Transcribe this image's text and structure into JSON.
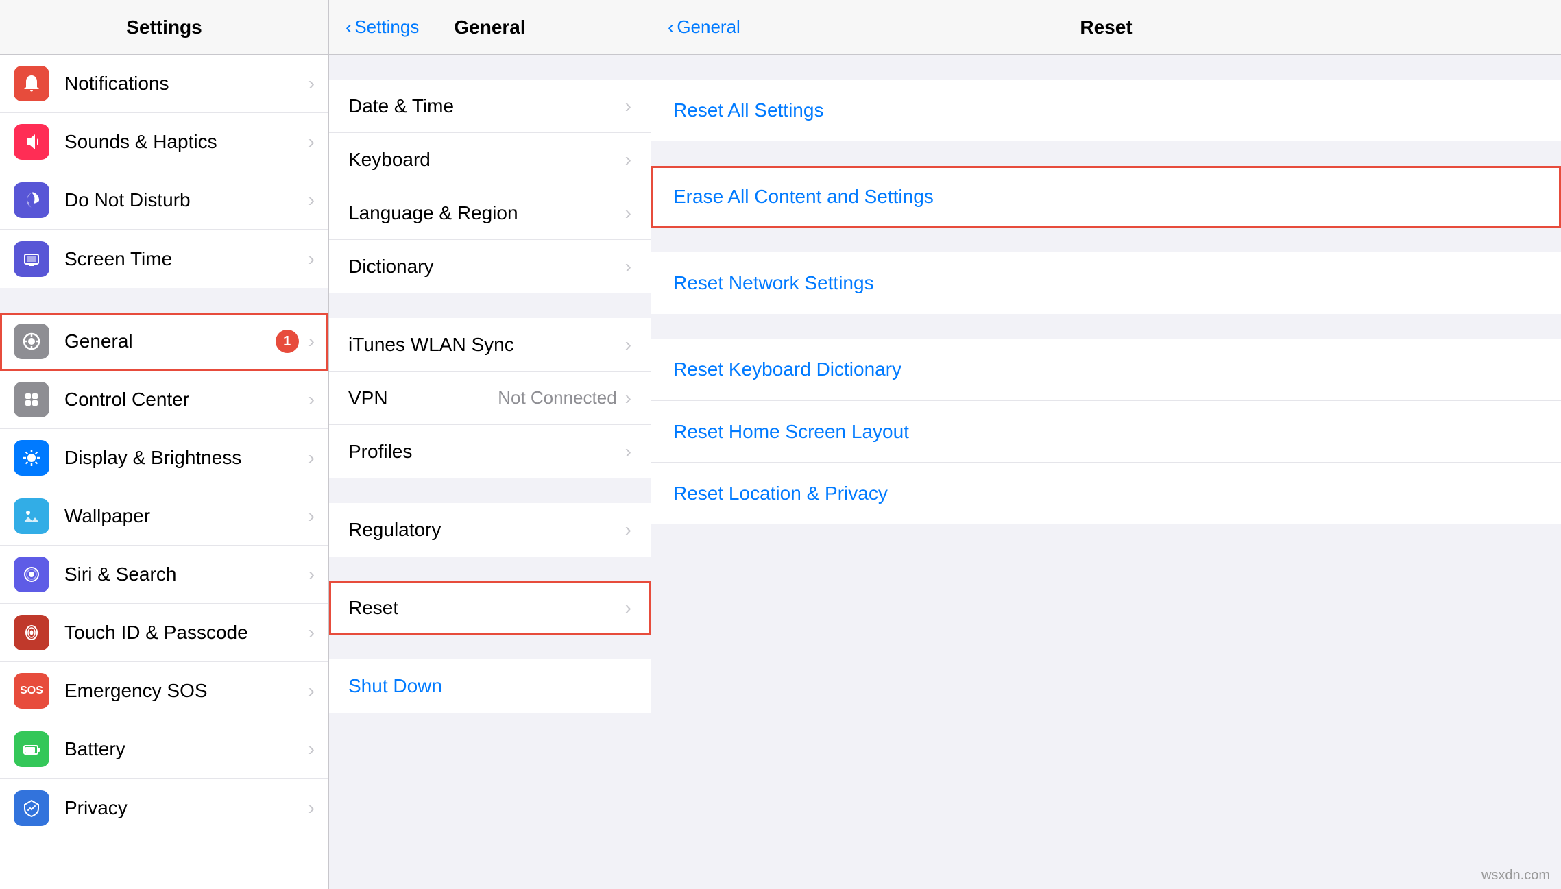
{
  "settings_col": {
    "title": "Settings",
    "items": [
      {
        "id": "notifications",
        "label": "Notifications",
        "icon_color": "icon-red",
        "icon_symbol": "🔔",
        "badge": null,
        "highlighted": false
      },
      {
        "id": "sounds-haptics",
        "label": "Sounds & Haptics",
        "icon_color": "icon-pink",
        "icon_symbol": "🔊",
        "badge": null,
        "highlighted": false
      },
      {
        "id": "do-not-disturb",
        "label": "Do Not Disturb",
        "icon_color": "icon-purple",
        "icon_symbol": "🌙",
        "badge": null,
        "highlighted": false
      },
      {
        "id": "screen-time",
        "label": "Screen Time",
        "icon_color": "icon-purple",
        "icon_symbol": "⏱",
        "badge": null,
        "highlighted": false
      },
      {
        "id": "general",
        "label": "General",
        "icon_color": "icon-gray",
        "icon_symbol": "⚙️",
        "badge": "1",
        "highlighted": true
      },
      {
        "id": "control-center",
        "label": "Control Center",
        "icon_color": "icon-gray",
        "icon_symbol": "⊞",
        "badge": null,
        "highlighted": false
      },
      {
        "id": "display-brightness",
        "label": "Display & Brightness",
        "icon_color": "icon-blue",
        "icon_symbol": "☀",
        "badge": null,
        "highlighted": false
      },
      {
        "id": "wallpaper",
        "label": "Wallpaper",
        "icon_color": "icon-teal",
        "icon_symbol": "🌸",
        "badge": null,
        "highlighted": false
      },
      {
        "id": "siri-search",
        "label": "Siri & Search",
        "icon_color": "icon-indigo",
        "icon_symbol": "◉",
        "badge": null,
        "highlighted": false
      },
      {
        "id": "touch-id",
        "label": "Touch ID & Passcode",
        "icon_color": "icon-pink2",
        "icon_symbol": "◎",
        "badge": null,
        "highlighted": false
      },
      {
        "id": "emergency-sos",
        "label": "Emergency SOS",
        "icon_color": "icon-red",
        "icon_symbol": "SOS",
        "badge": null,
        "highlighted": false
      },
      {
        "id": "battery",
        "label": "Battery",
        "icon_color": "icon-green",
        "icon_symbol": "🔋",
        "badge": null,
        "highlighted": false
      },
      {
        "id": "privacy",
        "label": "Privacy",
        "icon_color": "icon-blue",
        "icon_symbol": "✋",
        "badge": null,
        "highlighted": false
      }
    ]
  },
  "general_col": {
    "title": "General",
    "back_label": "Settings",
    "items_top": [],
    "groups": [
      {
        "items": [
          {
            "id": "date-time",
            "label": "Date & Time",
            "value": null
          },
          {
            "id": "keyboard",
            "label": "Keyboard",
            "value": null
          },
          {
            "id": "language-region",
            "label": "Language & Region",
            "value": null
          },
          {
            "id": "dictionary",
            "label": "Dictionary",
            "value": null
          }
        ]
      },
      {
        "items": [
          {
            "id": "itunes-wlan",
            "label": "iTunes WLAN Sync",
            "value": null
          },
          {
            "id": "vpn",
            "label": "VPN",
            "value": "Not Connected"
          },
          {
            "id": "profiles",
            "label": "Profiles",
            "value": null
          }
        ]
      },
      {
        "items": [
          {
            "id": "regulatory",
            "label": "Regulatory",
            "value": null
          }
        ]
      },
      {
        "items": [
          {
            "id": "reset",
            "label": "Reset",
            "value": null,
            "highlighted": true
          }
        ]
      }
    ],
    "shut_down": "Shut Down"
  },
  "reset_col": {
    "title": "Reset",
    "back_label": "General",
    "groups": [
      {
        "items": [
          {
            "id": "reset-all-settings",
            "label": "Reset All Settings",
            "highlighted": false
          }
        ]
      },
      {
        "items": [
          {
            "id": "erase-all",
            "label": "Erase All Content and Settings",
            "highlighted": true
          }
        ]
      },
      {
        "items": [
          {
            "id": "reset-network",
            "label": "Reset Network Settings",
            "highlighted": false
          }
        ]
      },
      {
        "items": [
          {
            "id": "reset-keyboard",
            "label": "Reset Keyboard Dictionary",
            "highlighted": false
          },
          {
            "id": "reset-home-screen",
            "label": "Reset Home Screen Layout",
            "highlighted": false
          },
          {
            "id": "reset-location",
            "label": "Reset Location & Privacy",
            "highlighted": false
          }
        ]
      }
    ]
  },
  "watermark": "wsxdn.com"
}
